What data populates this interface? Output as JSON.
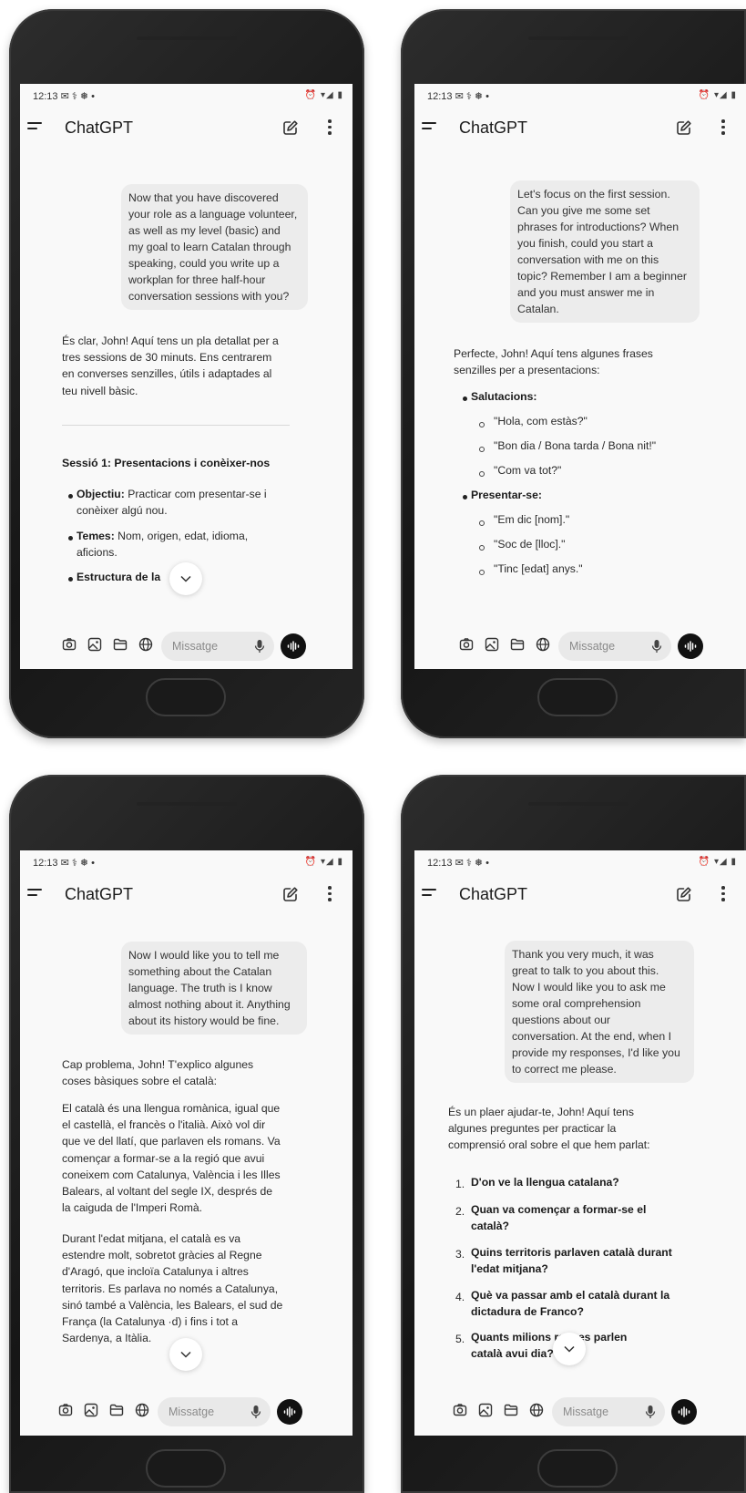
{
  "phones": [
    {
      "status_time": "12:13 ✉ ⚕ ❅ •",
      "status_icons": "⏰ ▾◢ ▮",
      "app_title": "ChatGPT",
      "composer_placeholder": "Missatge",
      "user_message": [
        "Now that you have discovered",
        "your role as a language volunteer,",
        "as well as my level (basic) and",
        "my goal to learn Catalan through",
        "speaking, could you write up a",
        "workplan for three half-hour",
        "conversation sessions with you?"
      ],
      "assistant_intro": [
        "És clar, John! Aquí tens un pla detallat per a",
        "tres sessions de 30 minuts. Ens centrarem",
        "en converses senzilles, útils i adaptades al",
        "teu nivell bàsic."
      ],
      "section_heading": "Sessió 1: Presentacions i conèixer-nos",
      "bullets": [
        {
          "label": "Objectiu:",
          "lines": [
            "Practicar com presentar-se i",
            "conèixer algú nou."
          ]
        },
        {
          "label": "Temes:",
          "lines": [
            "Nom, origen, edat, idioma,",
            "aficions."
          ]
        },
        {
          "label": "Estructura de la",
          "lines": [
            ":"
          ]
        }
      ]
    },
    {
      "status_time": "12:13 ✉ ⚕ ❅ •",
      "status_icons": "⏰ ▾◢ ▮",
      "app_title": "ChatGPT",
      "composer_placeholder": "Missatge",
      "user_message": [
        "Let's focus on the first session.",
        "Can you give me some set",
        "phrases for introductions? When",
        "you finish, could you start a",
        "conversation with me on this",
        "topic? Remember I am a beginner",
        "and you must answer me in",
        "Catalan."
      ],
      "assistant_intro": [
        "Perfecte, John! Aquí tens algunes frases",
        "senzilles per a presentacions:"
      ],
      "groups": [
        {
          "label": "Salutacions:",
          "items": [
            "\"Hola, com estàs?\"",
            "\"Bon dia / Bona tarda / Bona nit!\"",
            "\"Com va tot?\""
          ]
        },
        {
          "label": "Presentar-se:",
          "items": [
            "\"Em dic [nom].\"",
            "\"Soc de [lloc].\"",
            "\"Tinc [edat] anys.\""
          ]
        }
      ]
    },
    {
      "status_time": "12:13 ✉ ⚕ ❅ •",
      "status_icons": "⏰ ▾◢ ▮",
      "app_title": "ChatGPT",
      "composer_placeholder": "Missatge",
      "user_message": [
        "Now I would like you to tell me",
        "something about the Catalan",
        "language. The truth is I know",
        "almost nothing about it. Anything",
        "about its history would be fine."
      ],
      "assistant_intro": [
        "Cap problema, John! T'explico algunes",
        "coses bàsiques sobre el català:"
      ],
      "paragraph1": [
        "El català és una llengua romànica, igual que",
        "el castellà, el francès o l'italià. Això vol dir",
        "que ve del llatí, que parlaven els romans. Va",
        "començar a formar-se a la regió que avui",
        "coneixem com Catalunya, València i les Illes",
        "Balears, al voltant del segle IX, després de",
        "la caiguda de l'Imperi Romà."
      ],
      "paragraph2": [
        "Durant l'edat mitjana, el català es va",
        "estendre molt, sobretot gràcies al Regne",
        "d'Aragó, que incloïa Catalunya i altres",
        "territoris. Es parlava no només a Catalunya,",
        "sinó també a València, les Balears, el sud de",
        "França (la Catalunya    ·d) i fins i tot a",
        "Sardenya, a Itàlia."
      ]
    },
    {
      "status_time": "12:13 ✉ ⚕ ❅ •",
      "status_icons": "⏰ ▾◢ ▮",
      "app_title": "ChatGPT",
      "composer_placeholder": "Missatge",
      "user_message": [
        "Thank you very much, it was",
        "great to talk to you about this.",
        "Now I would like you to ask me",
        "some oral comprehension",
        "questions about our",
        "conversation. At the end, when I",
        "provide my responses, I'd like you",
        "to correct me please."
      ],
      "assistant_intro": [
        "És un plaer ajudar-te, John! Aquí tens",
        "algunes preguntes per practicar la",
        "comprensió oral sobre el que hem parlat:"
      ],
      "questions": [
        {
          "n": "1.",
          "lines": [
            "D'on ve la llengua catalana?"
          ]
        },
        {
          "n": "2.",
          "lines": [
            "Quan va començar a formar-se el",
            "català?"
          ]
        },
        {
          "n": "3.",
          "lines": [
            "Quins territoris parlaven català durant",
            "l'edat mitjana?"
          ]
        },
        {
          "n": "4.",
          "lines": [
            "Què va passar amb el català durant la",
            "dictadura de Franco?"
          ]
        },
        {
          "n": "5.",
          "lines": [
            "Quants milions        rsones parlen",
            "català avui dia?"
          ]
        }
      ]
    }
  ]
}
